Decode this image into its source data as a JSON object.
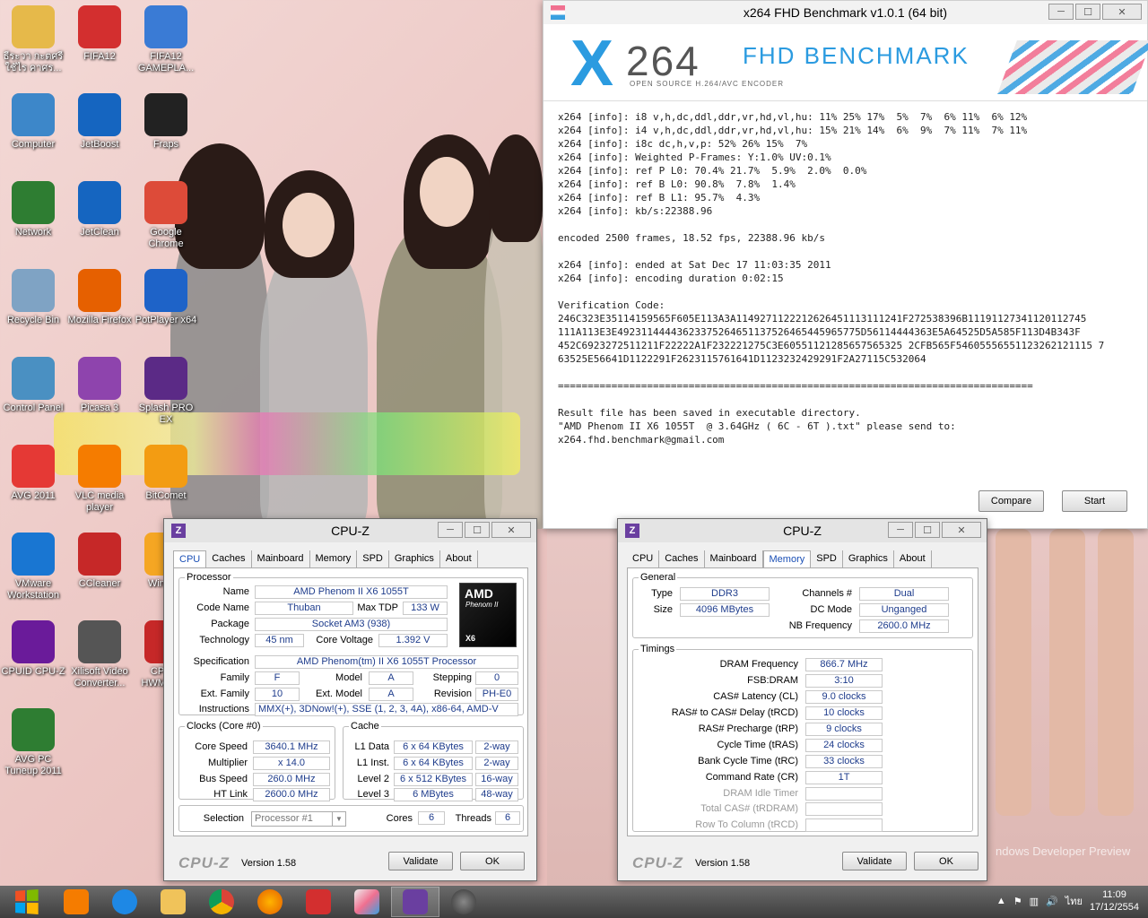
{
  "desktop": {
    "icons": [
      {
        "id": "user",
        "label": "ธีระวา กะตศรี ใช้ไร คาศร...",
        "icon": "folder-user-icon",
        "color": "#e6b94a"
      },
      {
        "id": "fifa12",
        "label": "FIFA12",
        "icon": "fifa-icon",
        "color": "#d32f2f"
      },
      {
        "id": "fifa12-gameplay",
        "label": "FIFA12 GAMEPLA...",
        "icon": "gameplay-icon",
        "color": "#3a7bd5"
      },
      {
        "id": "computer",
        "label": "Computer",
        "icon": "computer-icon",
        "color": "#3d87c9"
      },
      {
        "id": "jetboost",
        "label": "JetBoost",
        "icon": "jetboost-icon",
        "color": "#1565c0"
      },
      {
        "id": "fraps",
        "label": "Fraps",
        "icon": "fraps-icon",
        "color": "#222"
      },
      {
        "id": "network",
        "label": "Network",
        "icon": "network-icon",
        "color": "#2e7d32"
      },
      {
        "id": "jetclean",
        "label": "JetClean",
        "icon": "jetclean-icon",
        "color": "#1565c0"
      },
      {
        "id": "chrome",
        "label": "Google Chrome",
        "icon": "chrome-icon",
        "color": "#dd4b39"
      },
      {
        "id": "recycle",
        "label": "Recycle Bin",
        "icon": "recycle-bin-icon",
        "color": "#7fa3c4"
      },
      {
        "id": "firefox",
        "label": "Mozilla Firefox",
        "icon": "firefox-icon",
        "color": "#e66000"
      },
      {
        "id": "potplayer",
        "label": "PotPlayer x64",
        "icon": "potplayer-icon",
        "color": "#1e63c8"
      },
      {
        "id": "control",
        "label": "Control Panel",
        "icon": "control-panel-icon",
        "color": "#4a90c2"
      },
      {
        "id": "picasa",
        "label": "Picasa 3",
        "icon": "picasa-icon",
        "color": "#8e44ad"
      },
      {
        "id": "splash",
        "label": "Splash PRO EX",
        "icon": "splash-icon",
        "color": "#5b2a86"
      },
      {
        "id": "avg",
        "label": "AVG 2011",
        "icon": "avg-icon",
        "color": "#e53935"
      },
      {
        "id": "vlc",
        "label": "VLC media player",
        "icon": "vlc-icon",
        "color": "#f57c00"
      },
      {
        "id": "bitcomet",
        "label": "BitComet",
        "icon": "bitcomet-icon",
        "color": "#f39c12"
      },
      {
        "id": "vmware",
        "label": "VMware Workstation",
        "icon": "vmware-icon",
        "color": "#1976d2"
      },
      {
        "id": "ccleaner",
        "label": "CCleaner",
        "icon": "ccleaner-icon",
        "color": "#c62828"
      },
      {
        "id": "winamp",
        "label": "Winamp",
        "icon": "winamp-icon",
        "color": "#f5a623"
      },
      {
        "id": "cpuz",
        "label": "CPUID CPU-Z",
        "icon": "cpuz-icon",
        "color": "#6a1b9a"
      },
      {
        "id": "xilisoft",
        "label": "Xilisoft Video Converter...",
        "icon": "film-reel-icon",
        "color": "#555"
      },
      {
        "id": "hwmonitor",
        "label": "CPUID HWMonitor",
        "icon": "hwmonitor-icon",
        "color": "#c62828"
      },
      {
        "id": "avgtuneup",
        "label": "AVG PC Tuneup 2011",
        "icon": "tuneup-icon",
        "color": "#2e7d32"
      }
    ]
  },
  "x264": {
    "title": "x264 FHD Benchmark v1.0.1 (64 bit)",
    "banner_x": "X",
    "banner_num": "264",
    "banner_text": "FHD BENCHMARK",
    "banner_sub": "OPEN SOURCE H.264/AVC ENCODER",
    "log": "x264 [info]: i8 v,h,dc,ddl,ddr,vr,hd,vl,hu: 11% 25% 17%  5%  7%  6% 11%  6% 12%\nx264 [info]: i4 v,h,dc,ddl,ddr,vr,hd,vl,hu: 15% 21% 14%  6%  9%  7% 11%  7% 11%\nx264 [info]: i8c dc,h,v,p: 52% 26% 15%  7%\nx264 [info]: Weighted P-Frames: Y:1.0% UV:0.1%\nx264 [info]: ref P L0: 70.4% 21.7%  5.9%  2.0%  0.0%\nx264 [info]: ref B L0: 90.8%  7.8%  1.4%\nx264 [info]: ref B L1: 95.7%  4.3%\nx264 [info]: kb/s:22388.96\n\nencoded 2500 frames, 18.52 fps, 22388.96 kb/s\n\nx264 [info]: ended at Sat Dec 17 11:03:35 2011\nx264 [info]: encoding duration 0:02:15\n\nVerification Code:\n246C323E35114159565F605E113A3A1149271122212626451113111241F272538396B11191127341120112745\n111A113E3E49231144443623375264651137526465445965775D56114444363E5A64525D5A585F113D4B343F\n452C6923272511211F22222A1F232221275C3E60551121285657565325 2CFB565F54605556551123262121115 7\n63525E56641D1122291F2623115761641D1123232429291F2A27115C532064\n\n================================================================================\n\nResult file has been saved in executable directory.\n\"AMD Phenom II X6 1055T  @ 3.64GHz ( 6C - 6T ).txt\" please send to:\nx264.fhd.benchmark@gmail.com",
    "compare": "Compare",
    "start": "Start"
  },
  "cpuz1": {
    "title": "CPU-Z",
    "tabs": [
      "CPU",
      "Caches",
      "Mainboard",
      "Memory",
      "SPD",
      "Graphics",
      "About"
    ],
    "active_tab": "CPU",
    "processor_legend": "Processor",
    "name_lbl": "Name",
    "name": "AMD Phenom II X6 1055T",
    "codename_lbl": "Code Name",
    "codename": "Thuban",
    "maxtdp_lbl": "Max TDP",
    "maxtdp": "133 W",
    "package_lbl": "Package",
    "package": "Socket AM3 (938)",
    "tech_lbl": "Technology",
    "tech": "45 nm",
    "corev_lbl": "Core Voltage",
    "corev": "1.392 V",
    "spec_lbl": "Specification",
    "spec": "AMD Phenom(tm) II X6 1055T Processor",
    "family_lbl": "Family",
    "family": "F",
    "model_lbl": "Model",
    "model": "A",
    "stepping_lbl": "Stepping",
    "stepping": "0",
    "extfamily_lbl": "Ext. Family",
    "extfamily": "10",
    "extmodel_lbl": "Ext. Model",
    "extmodel": "A",
    "revision_lbl": "Revision",
    "revision": "PH-E0",
    "instr_lbl": "Instructions",
    "instr": "MMX(+), 3DNow!(+), SSE (1, 2, 3, 4A), x86-64, AMD-V",
    "amd_logo": "AMD",
    "phenom_logo": "Phenom II",
    "x6_logo": "X6",
    "clocks_legend": "Clocks (Core #0)",
    "corespeed_lbl": "Core Speed",
    "corespeed": "3640.1 MHz",
    "mult_lbl": "Multiplier",
    "mult": "x 14.0",
    "bus_lbl": "Bus Speed",
    "bus": "260.0 MHz",
    "ht_lbl": "HT Link",
    "ht": "2600.0 MHz",
    "cache_legend": "Cache",
    "l1d_lbl": "L1 Data",
    "l1d": "6 x 64 KBytes",
    "l1d_way": "2-way",
    "l1i_lbl": "L1 Inst.",
    "l1i": "6 x 64 KBytes",
    "l1i_way": "2-way",
    "l2_lbl": "Level 2",
    "l2": "6 x 512 KBytes",
    "l2_way": "16-way",
    "l3_lbl": "Level 3",
    "l3": "6 MBytes",
    "l3_way": "48-way",
    "sel_lbl": "Selection",
    "sel": "Processor #1",
    "cores_lbl": "Cores",
    "cores": "6",
    "threads_lbl": "Threads",
    "threads": "6",
    "brand": "CPU-Z",
    "version": "Version 1.58",
    "validate": "Validate",
    "ok": "OK"
  },
  "cpuz2": {
    "title": "CPU-Z",
    "tabs": [
      "CPU",
      "Caches",
      "Mainboard",
      "Memory",
      "SPD",
      "Graphics",
      "About"
    ],
    "active_tab": "Memory",
    "general_legend": "General",
    "type_lbl": "Type",
    "type": "DDR3",
    "channels_lbl": "Channels #",
    "channels": "Dual",
    "size_lbl": "Size",
    "size": "4096 MBytes",
    "dcmode_lbl": "DC Mode",
    "dcmode": "Unganged",
    "nbfreq_lbl": "NB Frequency",
    "nbfreq": "2600.0 MHz",
    "timings_legend": "Timings",
    "dram_lbl": "DRAM Frequency",
    "dram": "866.7 MHz",
    "fsb_lbl": "FSB:DRAM",
    "fsb": "3:10",
    "cl_lbl": "CAS# Latency (CL)",
    "cl": "9.0 clocks",
    "trcd_lbl": "RAS# to CAS# Delay (tRCD)",
    "trcd": "10 clocks",
    "trp_lbl": "RAS# Precharge (tRP)",
    "trp": "9 clocks",
    "tras_lbl": "Cycle Time (tRAS)",
    "tras": "24 clocks",
    "trc_lbl": "Bank Cycle Time (tRC)",
    "trc": "33 clocks",
    "cr_lbl": "Command Rate (CR)",
    "cr": "1T",
    "idle_lbl": "DRAM Idle Timer",
    "trdram_lbl": "Total CAS# (tRDRAM)",
    "trcd2_lbl": "Row To Column (tRCD)",
    "brand": "CPU-Z",
    "version": "Version 1.58",
    "validate": "Validate",
    "ok": "OK"
  },
  "watermark": "ndows Developer Preview",
  "taskbar": {
    "lang": "ไทย",
    "time": "11:09",
    "date": "17/12/2554"
  },
  "colors": {
    "accent": "#1a4fb5",
    "value_text": "#1e3c8c",
    "x264_blue": "#2b9be0"
  }
}
